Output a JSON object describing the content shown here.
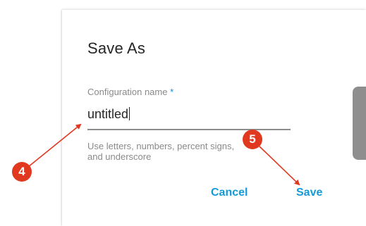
{
  "dialog": {
    "title": "Save As",
    "field": {
      "label": "Configuration name",
      "required_marker": "*",
      "value": "untitled",
      "hint": "Use letters, numbers, percent signs, and underscore"
    },
    "buttons": {
      "cancel_label": "Cancel",
      "save_label": "Save"
    }
  },
  "annotations": {
    "step_a": "4",
    "step_b": "5"
  },
  "colors": {
    "accent": "#159ad8",
    "annotation": "#e13920"
  }
}
